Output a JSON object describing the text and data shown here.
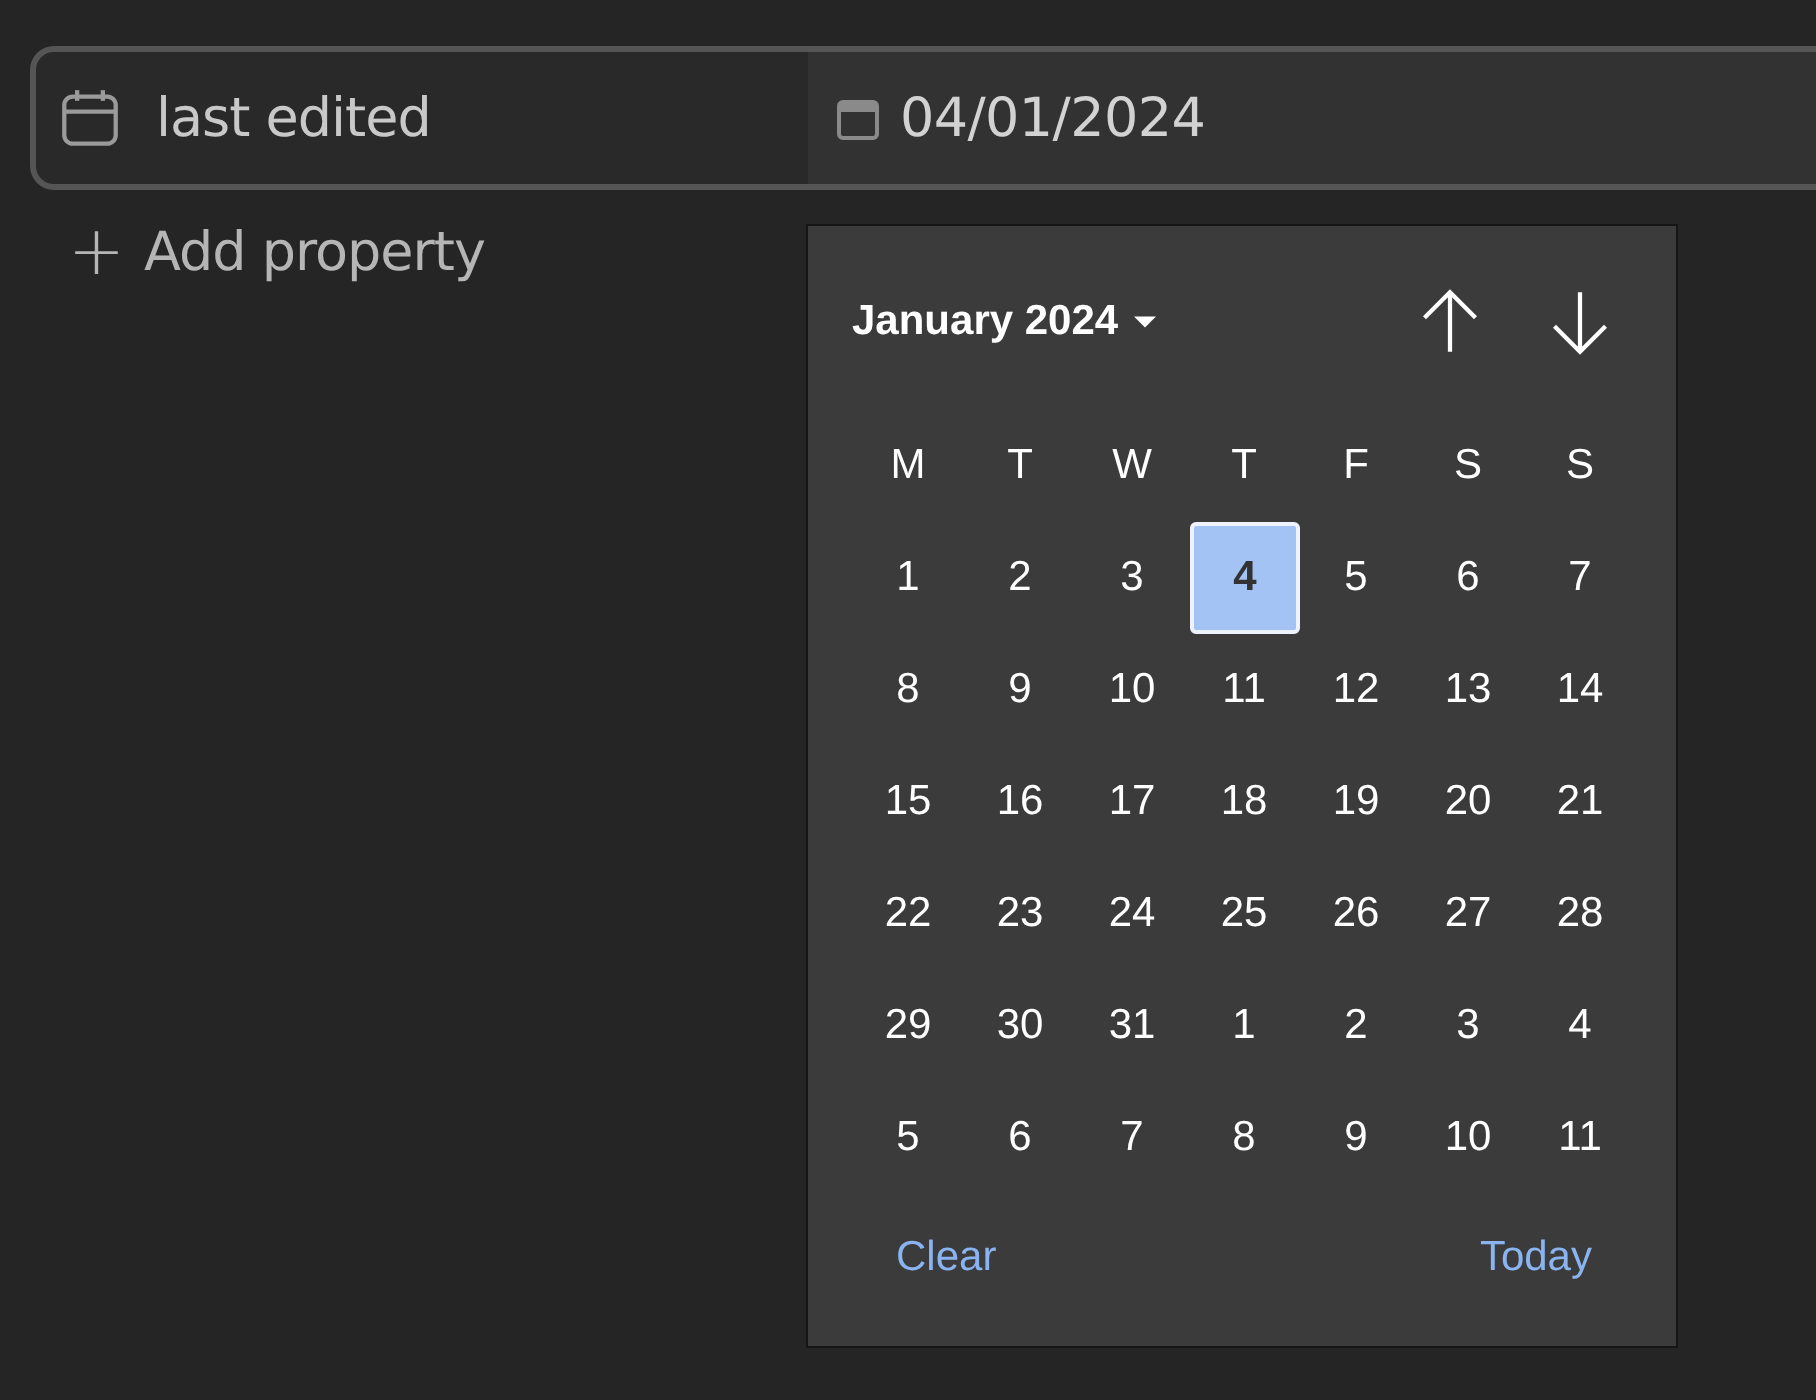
{
  "property": {
    "name": "last edited",
    "value": "04/01/2024"
  },
  "add_property": {
    "icon": "+",
    "label": "Add property"
  },
  "datepicker": {
    "month_label": "January 2024",
    "weekdays": [
      "M",
      "T",
      "W",
      "T",
      "F",
      "S",
      "S"
    ],
    "weeks": [
      [
        {
          "label": "1",
          "selected": false
        },
        {
          "label": "2",
          "selected": false
        },
        {
          "label": "3",
          "selected": false
        },
        {
          "label": "4",
          "selected": true
        },
        {
          "label": "5",
          "selected": false
        },
        {
          "label": "6",
          "selected": false
        },
        {
          "label": "7",
          "selected": false
        }
      ],
      [
        {
          "label": "8",
          "selected": false
        },
        {
          "label": "9",
          "selected": false
        },
        {
          "label": "10",
          "selected": false
        },
        {
          "label": "11",
          "selected": false
        },
        {
          "label": "12",
          "selected": false
        },
        {
          "label": "13",
          "selected": false
        },
        {
          "label": "14",
          "selected": false
        }
      ],
      [
        {
          "label": "15",
          "selected": false
        },
        {
          "label": "16",
          "selected": false
        },
        {
          "label": "17",
          "selected": false
        },
        {
          "label": "18",
          "selected": false
        },
        {
          "label": "19",
          "selected": false
        },
        {
          "label": "20",
          "selected": false
        },
        {
          "label": "21",
          "selected": false
        }
      ],
      [
        {
          "label": "22",
          "selected": false
        },
        {
          "label": "23",
          "selected": false
        },
        {
          "label": "24",
          "selected": false
        },
        {
          "label": "25",
          "selected": false
        },
        {
          "label": "26",
          "selected": false
        },
        {
          "label": "27",
          "selected": false
        },
        {
          "label": "28",
          "selected": false
        }
      ],
      [
        {
          "label": "29",
          "selected": false
        },
        {
          "label": "30",
          "selected": false
        },
        {
          "label": "31",
          "selected": false
        },
        {
          "label": "1",
          "selected": false
        },
        {
          "label": "2",
          "selected": false
        },
        {
          "label": "3",
          "selected": false
        },
        {
          "label": "4",
          "selected": false
        }
      ],
      [
        {
          "label": "5",
          "selected": false
        },
        {
          "label": "6",
          "selected": false
        },
        {
          "label": "7",
          "selected": false
        },
        {
          "label": "8",
          "selected": false
        },
        {
          "label": "9",
          "selected": false
        },
        {
          "label": "10",
          "selected": false
        },
        {
          "label": "11",
          "selected": false
        }
      ]
    ],
    "buttons": [
      "Clear",
      "Today"
    ]
  }
}
